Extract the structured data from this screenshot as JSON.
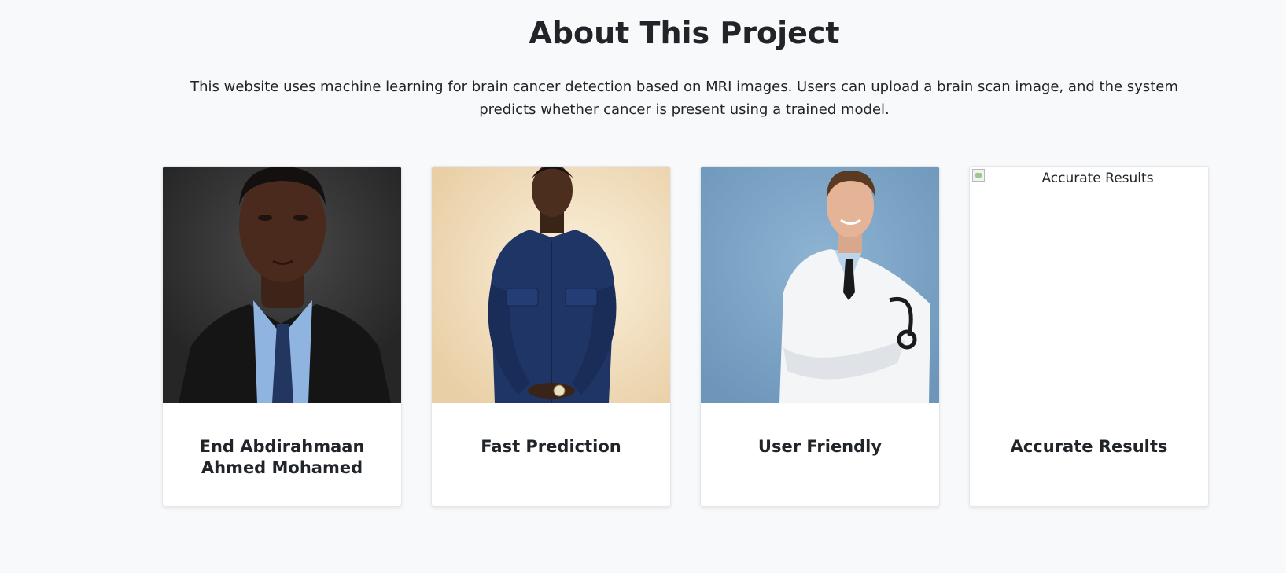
{
  "section": {
    "title": "About This Project",
    "description": "This website uses machine learning for brain cancer detection based on MRI images. Users can upload a brain scan image, and the system predicts whether cancer is present using a trained model."
  },
  "cards": [
    {
      "title": "End Abdirahmaan Ahmed Mohamed",
      "image": "portrait-man-suit-tie"
    },
    {
      "title": "Fast Prediction",
      "image": "portrait-man-denim-shirt"
    },
    {
      "title": "User Friendly",
      "image": "portrait-doctor-stethoscope"
    },
    {
      "title": "Accurate Results",
      "image": "broken-image",
      "alt": "Accurate Results"
    }
  ]
}
